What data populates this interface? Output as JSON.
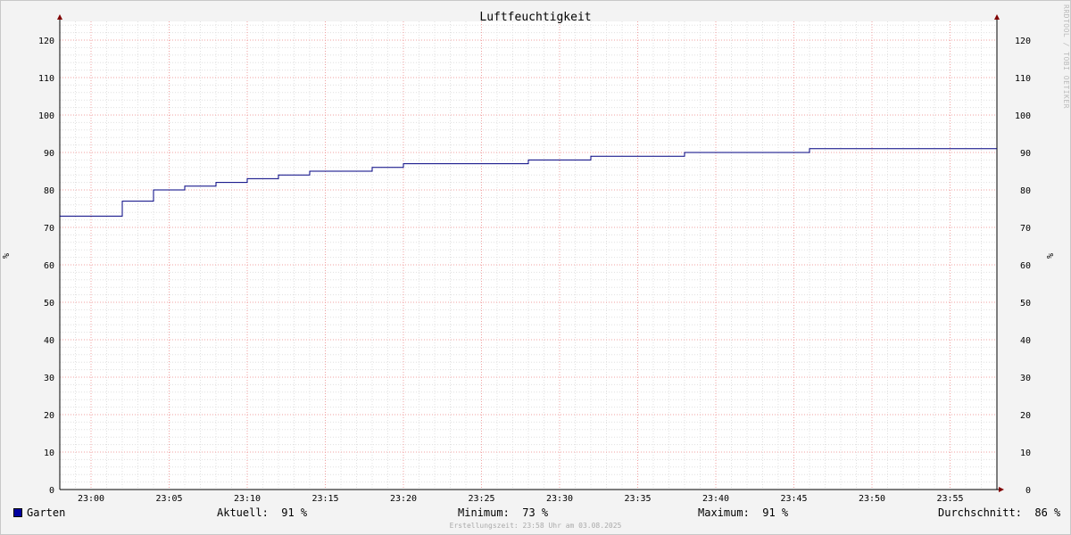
{
  "chart_data": {
    "type": "line",
    "title": "Luftfeuchtigkeit",
    "ylabel": "%",
    "ylim": [
      0,
      125
    ],
    "y_ticks": [
      0,
      10,
      20,
      30,
      40,
      50,
      60,
      70,
      80,
      90,
      100,
      110,
      120
    ],
    "xlim": [
      "22:58",
      "23:58"
    ],
    "x_ticks": [
      "23:00",
      "23:05",
      "23:10",
      "23:15",
      "23:20",
      "23:25",
      "23:30",
      "23:35",
      "23:40",
      "23:45",
      "23:50",
      "23:55"
    ],
    "grid": true,
    "series": [
      {
        "name": "Garten",
        "color": "#000080",
        "step": true,
        "points": [
          [
            "22:58",
            73
          ],
          [
            "23:02",
            77
          ],
          [
            "23:04",
            80
          ],
          [
            "23:06",
            81
          ],
          [
            "23:08",
            82
          ],
          [
            "23:10",
            83
          ],
          [
            "23:12",
            84
          ],
          [
            "23:14",
            85
          ],
          [
            "23:18",
            86
          ],
          [
            "23:20",
            87
          ],
          [
            "23:28",
            88
          ],
          [
            "23:32",
            89
          ],
          [
            "23:38",
            90
          ],
          [
            "23:46",
            91
          ],
          [
            "23:58",
            91
          ]
        ]
      }
    ]
  },
  "legend": {
    "swatch_color": "#0000a0",
    "name": "Garten",
    "current": "Aktuell:  91 %",
    "minimum": "Minimum:  73 %",
    "maximum": "Maximum:  91 %",
    "average": "Durchschnitt:  86 %"
  },
  "footer": "Erstellungszeit: 23:58 Uhr am 03.08.2025",
  "watermark": "RRDTOOL / TOBI OETIKER"
}
